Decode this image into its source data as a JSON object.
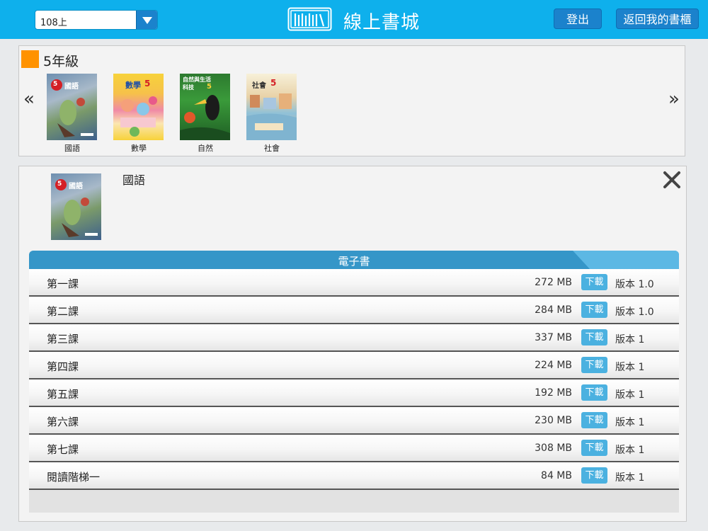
{
  "header": {
    "semester_value": "108上",
    "title": "線上書城",
    "logout_label": "登出",
    "back_label": "返回我的書櫃",
    "background_color": "#0eb0ec",
    "button_color": "#1b82cc"
  },
  "grade": {
    "title": "5年級",
    "swatch_color": "#ff9200",
    "prev_icon": "«",
    "next_icon": "»",
    "books": [
      {
        "label": "國語",
        "cover_text": "國語",
        "cover_badge": "5"
      },
      {
        "label": "數學",
        "cover_text": "數學",
        "cover_badge": "5"
      },
      {
        "label": "自然",
        "cover_text": "自然與生活科技",
        "cover_badge": "5"
      },
      {
        "label": "社會",
        "cover_text": "社會",
        "cover_badge": "5"
      }
    ]
  },
  "detail": {
    "title": "國語",
    "cover_text": "國語",
    "cover_badge": "5",
    "section_title": "電子書",
    "download_label": "下載",
    "items": [
      {
        "title": "第一課",
        "size": "272 MB",
        "version": "版本 1.0"
      },
      {
        "title": "第二課",
        "size": "284 MB",
        "version": "版本 1.0"
      },
      {
        "title": "第三課",
        "size": "337 MB",
        "version": "版本 1"
      },
      {
        "title": "第四課",
        "size": "224 MB",
        "version": "版本 1"
      },
      {
        "title": "第五課",
        "size": "192 MB",
        "version": "版本 1"
      },
      {
        "title": "第六課",
        "size": "230 MB",
        "version": "版本 1"
      },
      {
        "title": "第七課",
        "size": "308 MB",
        "version": "版本 1"
      },
      {
        "title": "閱讀階梯一",
        "size": "84 MB",
        "version": "版本 1"
      }
    ]
  }
}
